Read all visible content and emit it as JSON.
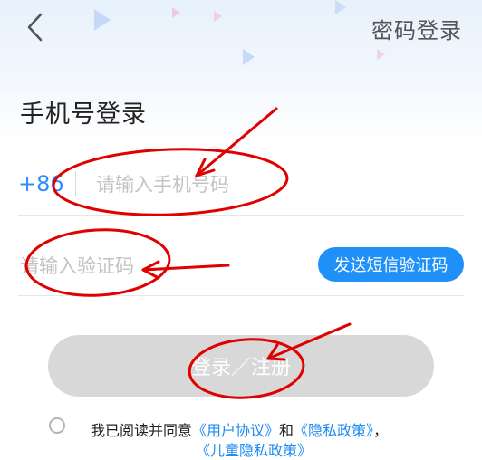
{
  "header": {
    "back_icon": "chevron-left-icon",
    "alt_login_label": "密码登录"
  },
  "title": "手机号登录",
  "phone": {
    "country_code": "+86",
    "placeholder": "请输入手机号码",
    "value": ""
  },
  "verification": {
    "placeholder": "请输入验证码",
    "value": "",
    "send_label": "发送短信验证码"
  },
  "login_button_label": "登录／注册",
  "agreement": {
    "prefix": "我已阅读并同意",
    "user_agreement": "《用户协议》",
    "conjunction": "和",
    "privacy_policy": "《隐私政策》",
    "separator": "，",
    "children_privacy": "《儿童隐私政策》",
    "checked": false
  },
  "colors": {
    "accent": "#1e90f8",
    "country_code": "#2f8cff",
    "disabled_button": "#d8d8d8",
    "annotation": "#e00000"
  }
}
